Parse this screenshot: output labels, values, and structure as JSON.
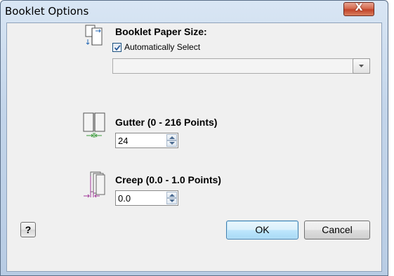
{
  "window": {
    "title": "Booklet Options",
    "close_glyph": "X"
  },
  "paper_size": {
    "icon": "booklet-paper-size-icon",
    "label": "Booklet Paper Size:",
    "auto_select_label": "Automatically Select",
    "auto_select_checked": true,
    "selected_value": ""
  },
  "gutter": {
    "icon": "gutter-icon",
    "label": "Gutter (0 - 216 Points)",
    "value": "24"
  },
  "creep": {
    "icon": "creep-icon",
    "label": "Creep (0.0 - 1.0 Points)",
    "value": "0.0"
  },
  "footer": {
    "help_label": "?",
    "ok_label": "OK",
    "cancel_label": "Cancel"
  },
  "colors": {
    "titlebar": "#c3d5ea",
    "close_button": "#c2442a",
    "ok_button_border": "#3c7fb1",
    "dialog_body": "#f0f0f0"
  }
}
